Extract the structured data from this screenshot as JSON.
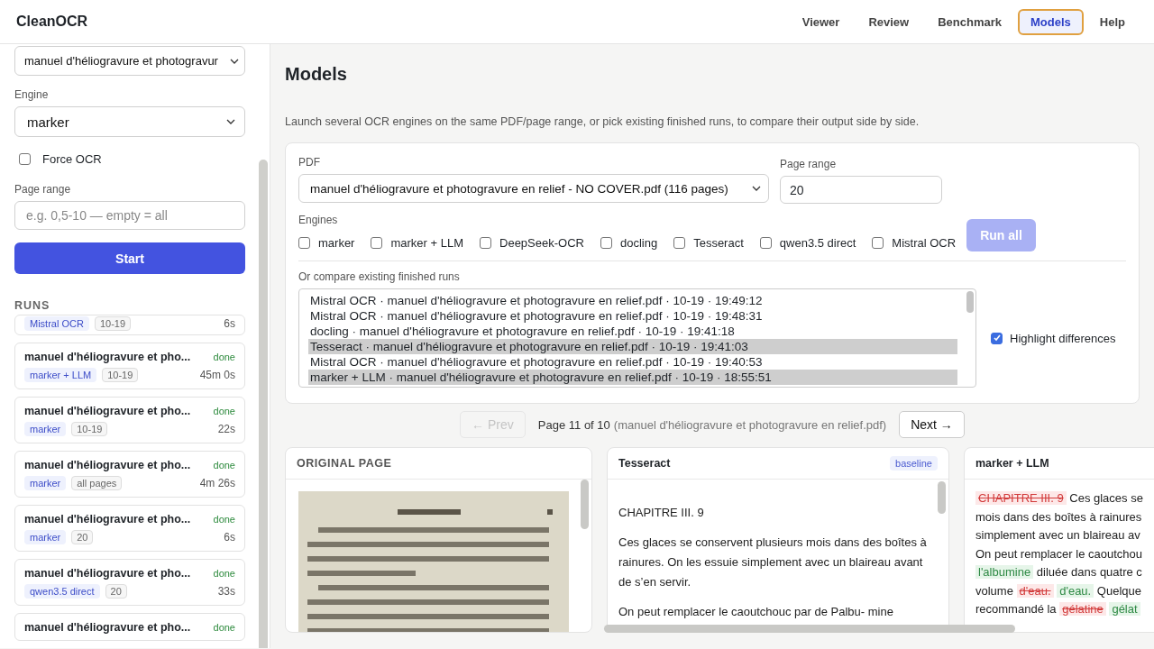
{
  "app": {
    "title": "CleanOCR"
  },
  "nav": [
    {
      "label": "Viewer",
      "selected": false
    },
    {
      "label": "Review",
      "selected": false
    },
    {
      "label": "Benchmark",
      "selected": false
    },
    {
      "label": "Models",
      "selected": true
    },
    {
      "label": "Help",
      "selected": false
    }
  ],
  "sidebar": {
    "pdf_select": {
      "value": "manuel d'héliogravure et photogravur"
    },
    "engine_label": "Engine",
    "engine_select": {
      "value": "marker"
    },
    "force_ocr": {
      "label": "Force OCR",
      "checked": false
    },
    "page_range": {
      "label": "Page range",
      "placeholder": "e.g. 0,5-10 — empty = all"
    },
    "start_button": "Start",
    "runs_heading": "RUNS",
    "runs": [
      {
        "engine": "Mistral OCR",
        "pages": "10-19",
        "duration": "6s"
      },
      {
        "title": "manuel d'héliogravure et pho...",
        "status": "done",
        "engine": "marker + LLM",
        "pages": "10-19",
        "duration": "45m 0s"
      },
      {
        "title": "manuel d'héliogravure et pho...",
        "status": "done",
        "engine": "marker",
        "pages": "10-19",
        "duration": "22s"
      },
      {
        "title": "manuel d'héliogravure et pho...",
        "status": "done",
        "engine": "marker",
        "pages": "all pages",
        "duration": "4m 26s"
      },
      {
        "title": "manuel d'héliogravure et pho...",
        "status": "done",
        "engine": "marker",
        "pages": "20",
        "duration": "6s"
      },
      {
        "title": "manuel d'héliogravure et pho...",
        "status": "done",
        "engine": "qwen3.5 direct",
        "pages": "20",
        "duration": "33s"
      },
      {
        "title": "manuel d'héliogravure et pho...",
        "status": "done"
      }
    ]
  },
  "main": {
    "page_title": "Models",
    "description": "Launch several OCR engines on the same PDF/page range, or pick existing finished runs, to compare their output side by side.",
    "launch": {
      "pdf_label": "PDF",
      "pdf_select": {
        "value": "manuel d'héliogravure et photogravure en relief - NO COVER.pdf (116 pages)"
      },
      "page_range_label": "Page range",
      "page_range_value": "20",
      "engines_label": "Engines",
      "engines": [
        {
          "label": "marker",
          "checked": false
        },
        {
          "label": "marker + LLM",
          "checked": false
        },
        {
          "label": "DeepSeek-OCR",
          "checked": false
        },
        {
          "label": "docling",
          "checked": false
        },
        {
          "label": "Tesseract",
          "checked": false
        },
        {
          "label": "qwen3.5 direct",
          "checked": false
        },
        {
          "label": "Mistral OCR",
          "checked": false
        }
      ],
      "run_all": {
        "label": "Run all",
        "disabled": true
      },
      "compare_label": "Or compare existing finished runs",
      "existing_runs": [
        {
          "label": "Mistral OCR · manuel d'héliogravure et photogravure en relief.pdf · 10-19 · 19:49:12",
          "selected": false
        },
        {
          "label": "Mistral OCR · manuel d'héliogravure et photogravure en relief.pdf · 10-19 · 19:48:31",
          "selected": false
        },
        {
          "label": "docling · manuel d'héliogravure et photogravure en relief.pdf · 10-19 · 19:41:18",
          "selected": false
        },
        {
          "label": "Tesseract · manuel d'héliogravure et photogravure en relief.pdf · 10-19 · 19:41:03",
          "selected": true
        },
        {
          "label": "Mistral OCR · manuel d'héliogravure et photogravure en relief.pdf · 10-19 · 19:40:53",
          "selected": false
        },
        {
          "label": "marker + LLM · manuel d'héliogravure et photogravure en relief.pdf · 10-19 · 18:55:51",
          "selected": true
        }
      ],
      "highlight": {
        "label": "Highlight differences",
        "checked": true
      }
    },
    "pager": {
      "prev": {
        "label": "← Prev",
        "disabled": true
      },
      "status": "Page 11 of 10",
      "source": "(manuel d'héliogravure et photogravure en relief.pdf)",
      "next": {
        "label": "Next →",
        "disabled": false
      }
    },
    "panels": [
      {
        "title": "ORIGINAL PAGE"
      },
      {
        "kind": "text",
        "title": "Tesseract",
        "badge": "baseline",
        "paragraphs": [
          "CHAPITRE III. 9",
          "Ces glaces se conservent plusieurs mois dans des boîtes à rainures. On les essuie simplement avec un blaireau avant de s’en servir.",
          "On peut remplacer le caoutchouc par de Palbu- mine"
        ]
      },
      {
        "kind": "diff",
        "title": "marker + LLM",
        "lines": [
          [
            {
              "kind": "del",
              "text": "CHAPITRE III. 9"
            },
            {
              "kind": "same",
              "text": "Ces glaces se"
            }
          ],
          [
            {
              "kind": "same",
              "text": "mois dans des boîtes à rainures"
            }
          ],
          [
            {
              "kind": "same",
              "text": "simplement avec un blaireau av"
            }
          ],
          [
            {
              "kind": "same",
              "text": "On peut remplacer le caoutchou"
            }
          ],
          [
            {
              "kind": "ins",
              "text": "l'albumine"
            },
            {
              "kind": "same",
              "text": "diluée dans quatre c"
            }
          ],
          [
            {
              "kind": "same",
              "text": "volume"
            },
            {
              "kind": "del",
              "text": "d'eau."
            },
            {
              "kind": "ins",
              "text": "d'eau."
            },
            {
              "kind": "same",
              "text": "Quelque"
            }
          ],
          [
            {
              "kind": "same",
              "text": "recommandé la"
            },
            {
              "kind": "del",
              "text": "gélatine"
            },
            {
              "kind": "ins",
              "text": "gélat"
            }
          ]
        ]
      }
    ]
  }
}
